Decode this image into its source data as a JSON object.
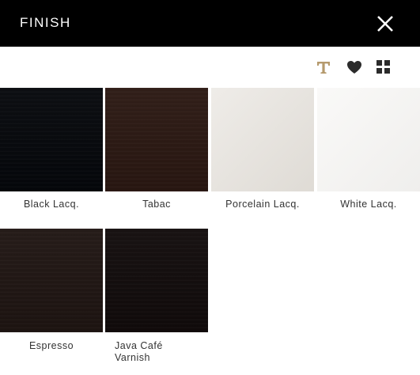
{
  "header": {
    "title": "FINISH"
  },
  "toolbar": {
    "icons": [
      "text-icon",
      "heart-icon",
      "grid-view-icon"
    ],
    "accent_color": "#b59a6d"
  },
  "finishes": [
    {
      "label": "Black Lacq.",
      "color": "#05070b"
    },
    {
      "label": "Tabac",
      "color": "#2b1812"
    },
    {
      "label": "Porcelain Lacq.",
      "color": "#e6e2dc"
    },
    {
      "label": "White Lacq.",
      "color": "#f7f6f4"
    },
    {
      "label": "Espresso",
      "color": "#1f1512"
    },
    {
      "label": "Java Café Varnish",
      "color": "#110b0b"
    }
  ]
}
